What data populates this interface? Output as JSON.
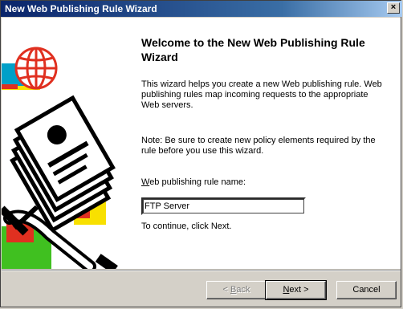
{
  "window": {
    "title": "New Web Publishing Rule Wizard",
    "close_glyph": "×"
  },
  "main": {
    "heading": "Welcome to the New Web Publishing Rule Wizard",
    "intro": "This wizard helps you create a new Web publishing rule. Web publishing rules map incoming requests to the appropriate Web servers.",
    "note": "Note: Be sure to create new policy elements required by the rule before you use this wizard.",
    "rule_name_label_accel": "W",
    "rule_name_label_rest": "eb publishing rule name:",
    "rule_name_value": "FTP Server",
    "continue_text": "To continue, click Next."
  },
  "buttons": {
    "back_prefix": "< ",
    "back_accel": "B",
    "back_rest": "ack",
    "next_accel": "N",
    "next_rest": "ext >",
    "cancel": "Cancel"
  },
  "colors": {
    "title_gradient_start": "#0a246a",
    "dialog_face": "#d4d0c8",
    "globe_red": "#e03020",
    "art_cyan": "#00a0c8",
    "art_yellow": "#f8e000",
    "art_green": "#40c020"
  }
}
